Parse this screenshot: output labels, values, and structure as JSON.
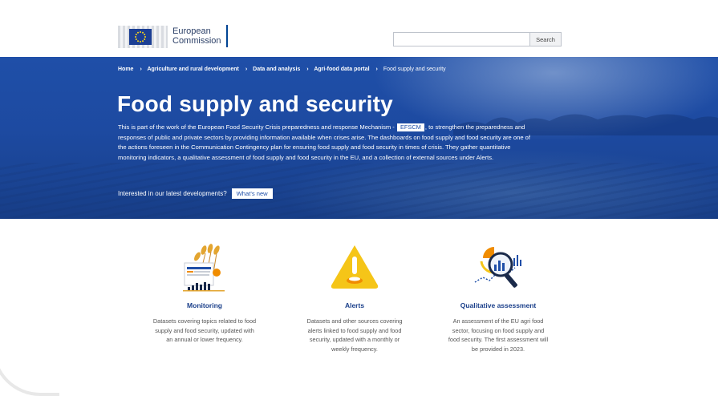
{
  "header": {
    "logo_line1": "European",
    "logo_line2": "Commission",
    "search_placeholder": "",
    "search_button": "Search"
  },
  "breadcrumb": [
    "Home",
    "Agriculture and rural development",
    "Data and analysis",
    "Agri-food data portal",
    "Food supply and security"
  ],
  "hero": {
    "title": "Food supply and security",
    "text_before": "This is part of the work of the European Food Security Crisis preparedness and response Mechanism -",
    "badge": "EFSCM",
    "text_after": ", to strengthen the preparedness and responses of public and private sectors by providing information available when crises arise. The dashboards on food supply and food security are one of the actions foreseen in the Communication Contingency plan for ensuring food supply and food security in times of crisis. They gather quantitative monitoring indicators, a qualitative assessment of food supply and food security in the EU, and a collection of external sources under Alerts.",
    "cta_text": "Interested in our latest developments?",
    "cta_button": "What's new"
  },
  "cards": [
    {
      "title": "Monitoring",
      "description": "Datasets covering topics related to food supply and food security, updated with an annual or lower frequency.",
      "icon": "monitoring-icon"
    },
    {
      "title": "Alerts",
      "description": "Datasets and other sources covering alerts linked to food supply and food security, updated with a monthly or weekly frequency.",
      "icon": "alert-icon"
    },
    {
      "title": "Qualitative assessment",
      "description": "An assessment of the EU agri food sector, focusing on food supply and food security. The first assessment will be provided in 2023.",
      "icon": "magnifier-chart-icon"
    }
  ],
  "colors": {
    "brand_blue": "#1f4fa8",
    "title_blue": "#1a3f8a",
    "alert_yellow": "#f5c518",
    "accent_orange": "#f08c00"
  }
}
